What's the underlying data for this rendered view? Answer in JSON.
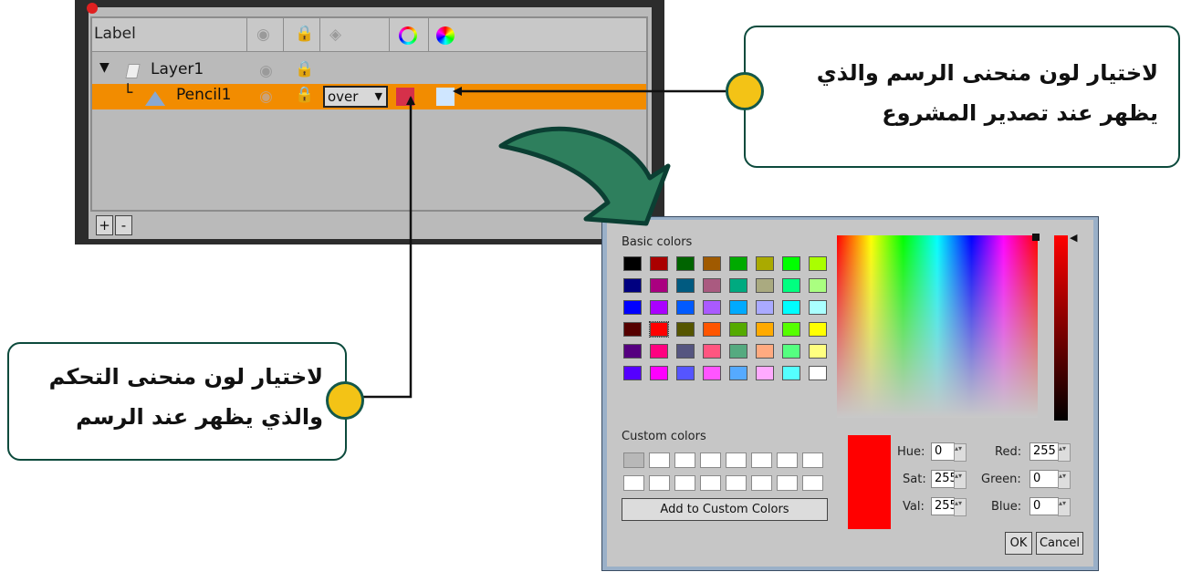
{
  "layer_panel": {
    "header": {
      "label": "Label"
    },
    "rows": [
      {
        "name": "Layer1"
      },
      {
        "name": "Pencil1",
        "blend_mode": "over",
        "control_color": "#d6304a",
        "render_color": "#cfe6ff"
      }
    ],
    "buttons": {
      "add": "+",
      "remove": "-"
    }
  },
  "callouts": {
    "render_color": {
      "line1": "لاختيار لون منحنى الرسم والذي",
      "line2": "يظهر عند تصدير المشروع"
    },
    "control_color": {
      "line1": "لاختيار لون منحنى التحكم",
      "line2": "والذي يظهر عند الرسم"
    }
  },
  "color_dialog": {
    "basic_colors_label": "Basic colors",
    "basic_colors": [
      [
        "#000000",
        "#aa0000",
        "#006400",
        "#a05a00",
        "#00aa00",
        "#aaaa00",
        "#00ff00",
        "#aaff00"
      ],
      [
        "#000080",
        "#aa0080",
        "#005a80",
        "#aa5a80",
        "#00aa80",
        "#aaaa80",
        "#00ff80",
        "#aaff80"
      ],
      [
        "#0000ff",
        "#aa00ff",
        "#005aff",
        "#aa5aff",
        "#00aaff",
        "#aaaaff",
        "#00ffff",
        "#aaffff"
      ],
      [
        "#550000",
        "#ff0000",
        "#555500",
        "#ff5500",
        "#55aa00",
        "#ffaa00",
        "#55ff00",
        "#ffff00"
      ],
      [
        "#550080",
        "#ff0080",
        "#555580",
        "#ff5580",
        "#55aa80",
        "#ffaa80",
        "#55ff80",
        "#ffff80"
      ],
      [
        "#5500ff",
        "#ff00ff",
        "#5555ff",
        "#ff55ff",
        "#55aaff",
        "#ffaaff",
        "#55ffff",
        "#ffffff"
      ]
    ],
    "custom_colors_label": "Custom colors",
    "add_custom_label": "Add to Custom Colors",
    "fields": {
      "hue": {
        "label": "Hue:",
        "value": "0"
      },
      "sat": {
        "label": "Sat:",
        "value": "255"
      },
      "val": {
        "label": "Val:",
        "value": "255"
      },
      "red": {
        "label": "Red:",
        "value": "255"
      },
      "green": {
        "label": "Green:",
        "value": "0"
      },
      "blue": {
        "label": "Blue:",
        "value": "0"
      }
    },
    "ok_label": "OK",
    "cancel_label": "Cancel"
  }
}
